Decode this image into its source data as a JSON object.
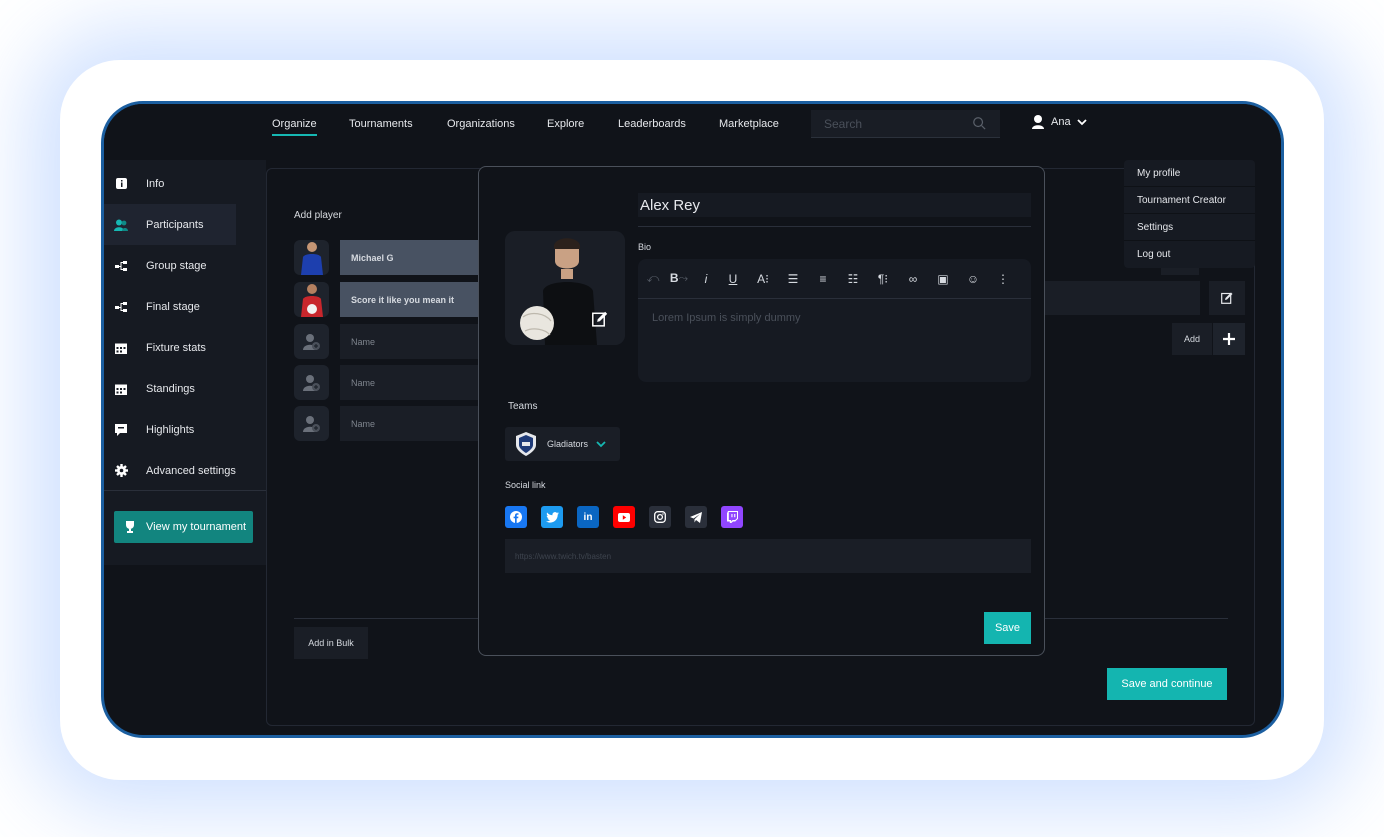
{
  "nav": {
    "items": [
      {
        "label": "Organize",
        "active": true
      },
      {
        "label": "Tournaments"
      },
      {
        "label": "Organizations"
      },
      {
        "label": "Explore"
      },
      {
        "label": "Leaderboards"
      },
      {
        "label": "Marketplace"
      }
    ],
    "search_placeholder": "Search",
    "user_name": "Ana"
  },
  "sidebar": {
    "items": [
      {
        "label": "Info",
        "icon": "info-icon"
      },
      {
        "label": "Participants",
        "icon": "users-icon",
        "active": true
      },
      {
        "label": "Group stage",
        "icon": "bracket-icon"
      },
      {
        "label": "Final stage",
        "icon": "bracket-icon"
      },
      {
        "label": "Fixture stats",
        "icon": "calendar-icon"
      },
      {
        "label": "Standings",
        "icon": "calendar-icon"
      },
      {
        "label": "Highlights",
        "icon": "message-icon"
      },
      {
        "label": "Advanced settings",
        "icon": "gear-icon"
      }
    ],
    "view_button": "View my tournament"
  },
  "participants": {
    "add_player_label": "Add player",
    "players": [
      {
        "name": "Michael G",
        "filled": true
      },
      {
        "name": "Score it like you mean it",
        "filled": true
      },
      {
        "name": "Name",
        "filled": false
      },
      {
        "name": "Name",
        "filled": false
      },
      {
        "name": "Name",
        "filled": false
      }
    ],
    "add_label": "Add",
    "bulk_label": "Add in Bulk",
    "save_continue": "Save and continue"
  },
  "dropdown": {
    "items": [
      "My profile",
      "Tournament Creator",
      "Settings",
      "Log out"
    ]
  },
  "modal": {
    "name_value": "Alex Rey",
    "bio_label": "Bio",
    "bio_placeholder": "Lorem Ipsum is simply dummy",
    "teams_label": "Teams",
    "team_name": "Gladiators",
    "social_label": "Social link",
    "link_placeholder": "https://www.twich.tv/basten",
    "save_label": "Save",
    "socials": [
      {
        "name": "facebook-icon",
        "color": "#1877f2",
        "glyph": "f"
      },
      {
        "name": "twitter-icon",
        "color": "#1d9bf0",
        "glyph": "t"
      },
      {
        "name": "linkedin-icon",
        "color": "#0a66c2",
        "glyph": "in"
      },
      {
        "name": "youtube-icon",
        "color": "#ff0000",
        "glyph": "▶"
      },
      {
        "name": "instagram-icon",
        "color": "#2a2f3a",
        "glyph": "◎"
      },
      {
        "name": "telegram-icon",
        "color": "#2a2f3a",
        "glyph": "➤"
      },
      {
        "name": "twitch-icon",
        "color": "#9146ff",
        "glyph": "▣"
      }
    ]
  },
  "colors": {
    "accent": "#14b5b0",
    "frame": "#1c5fa0",
    "background": "#101319"
  }
}
